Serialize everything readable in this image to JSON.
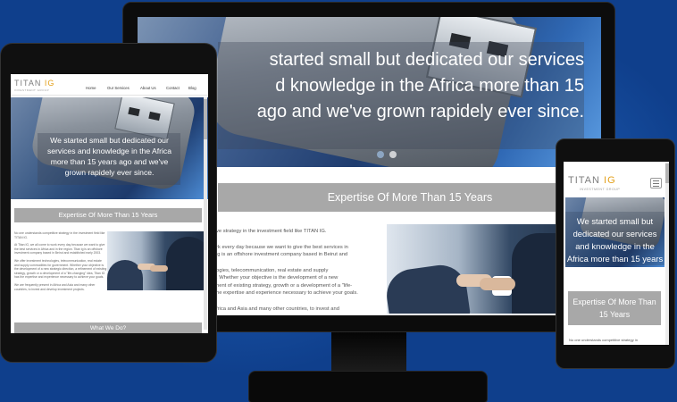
{
  "site": {
    "logo_main": "TITAN ",
    "logo_accent": "IG",
    "logo_sub": "INVESTMENT GROUP"
  },
  "nav": {
    "home": "Home",
    "services": "Our Services",
    "about": "About Us",
    "contact": "Contact",
    "blog": "Blog"
  },
  "desktop": {
    "hero_lines": [
      "started small but dedicated our services",
      "d knowledge in the Africa more than 15",
      "ago and we've grown rapidely ever since."
    ],
    "band": "Expertise Of More Than 15 Years",
    "body_lines": [
      "ve strategy in the investment field like TITAN IG.",
      "rk every day because we want to give the best services in",
      "ig is an offshore investment company based in Beirut and",
      "ogies, telecommunication, real estate and supply",
      ". Whether your objective is the development of a new",
      "nent of existing strategy, growth or a development of a \"life-",
      "he expertise and experience necessary to achieve your goals.",
      "frica and Asia and many other countries, to invest and"
    ]
  },
  "tablet": {
    "hero_lines": [
      "We started small but dedicated our",
      "services and knowledge in the Africa",
      "more than 15 years ago and we've",
      "grown rapidely ever since."
    ],
    "band": "Expertise Of More Than 15 Years",
    "body_p1": "No one understands competitive strategy in the investment field like TITAN IG.",
    "body_p2": "At Titan IG, we all come to work every day because we want to give the best services in Africa and in the region. Titan ig is an offshore investment company based in Beirut and established early 2003.",
    "body_p3": "We offer investment technologies, telecommunication, real estate and supply commodities for government. Whether your objective is the development of a new strategic direction, a refinement of existing strategy, growth or a development of a \"life-changing\" idea, Titan IG has the expertise and experience necessary to achieve your goals.",
    "body_p4": "We are frequently present in Africa and Asia and many other countries, to invest and develop investment projects.",
    "band2": "What We Do?"
  },
  "phone": {
    "hero_lines": [
      "We started small but",
      "dedicated our services",
      "and knowledge in the",
      "Africa more than 15 years"
    ],
    "band_lines": [
      "Expertise Of More Than",
      "15 Years"
    ],
    "body": "No one understands competitive strategy in"
  },
  "icons": {
    "menu": "hamburger-menu-icon"
  },
  "colors": {
    "background": "#0f3f8c",
    "band": "#a8a8a8",
    "logo_accent": "#e3a01b"
  }
}
